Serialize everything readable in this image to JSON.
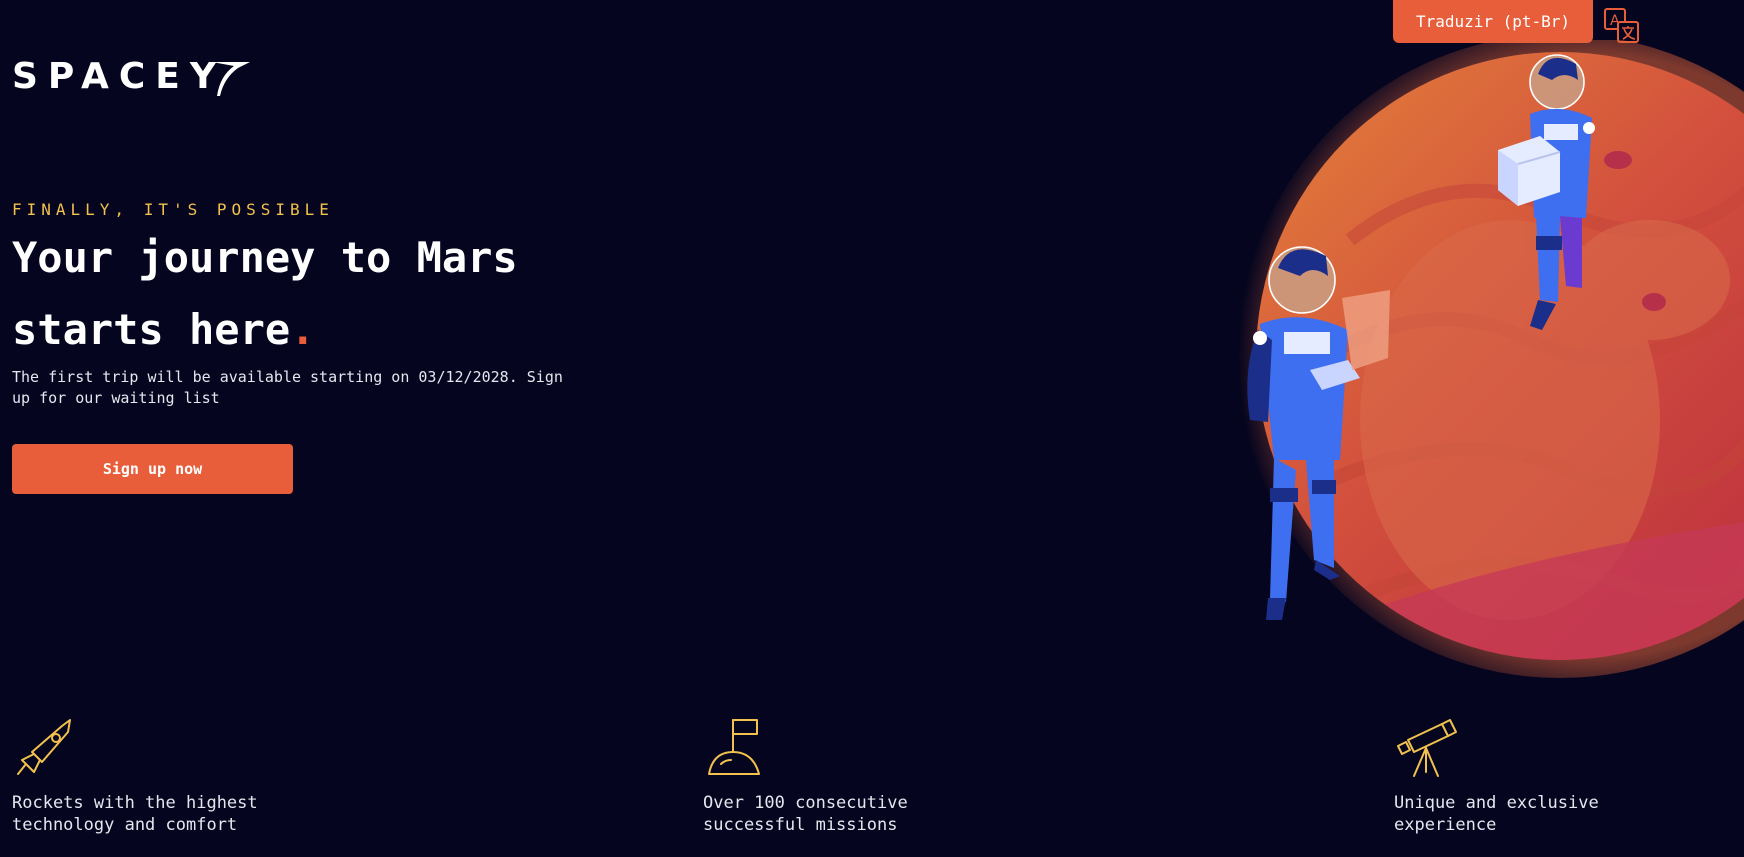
{
  "header": {
    "translate_label": "Traduzir (pt-Br)",
    "translate_icon": "translate-icon",
    "logo_text": "SPACEY"
  },
  "hero": {
    "kicker": "FINALLY, IT'S POSSIBLE",
    "headline": "Your journey to Mars starts here",
    "headline_dot": ".",
    "subtext": "The first trip will be available starting on 03/12/2028. Sign up for our waiting list",
    "cta_label": "Sign up now"
  },
  "features": [
    {
      "icon": "rocket-icon",
      "text": "Rockets with the highest\ntechnology and comfort"
    },
    {
      "icon": "moon-flag-icon",
      "text": "Over 100 consecutive\nsuccessful missions"
    },
    {
      "icon": "telescope-icon",
      "text": "Unique and exclusive\nexperience"
    }
  ],
  "colors": {
    "background": "#05051f",
    "accent": "#e85d3a",
    "highlight": "#f2c14e",
    "astronaut_suit": "#3e6ff0",
    "planet": "#d9523f"
  }
}
